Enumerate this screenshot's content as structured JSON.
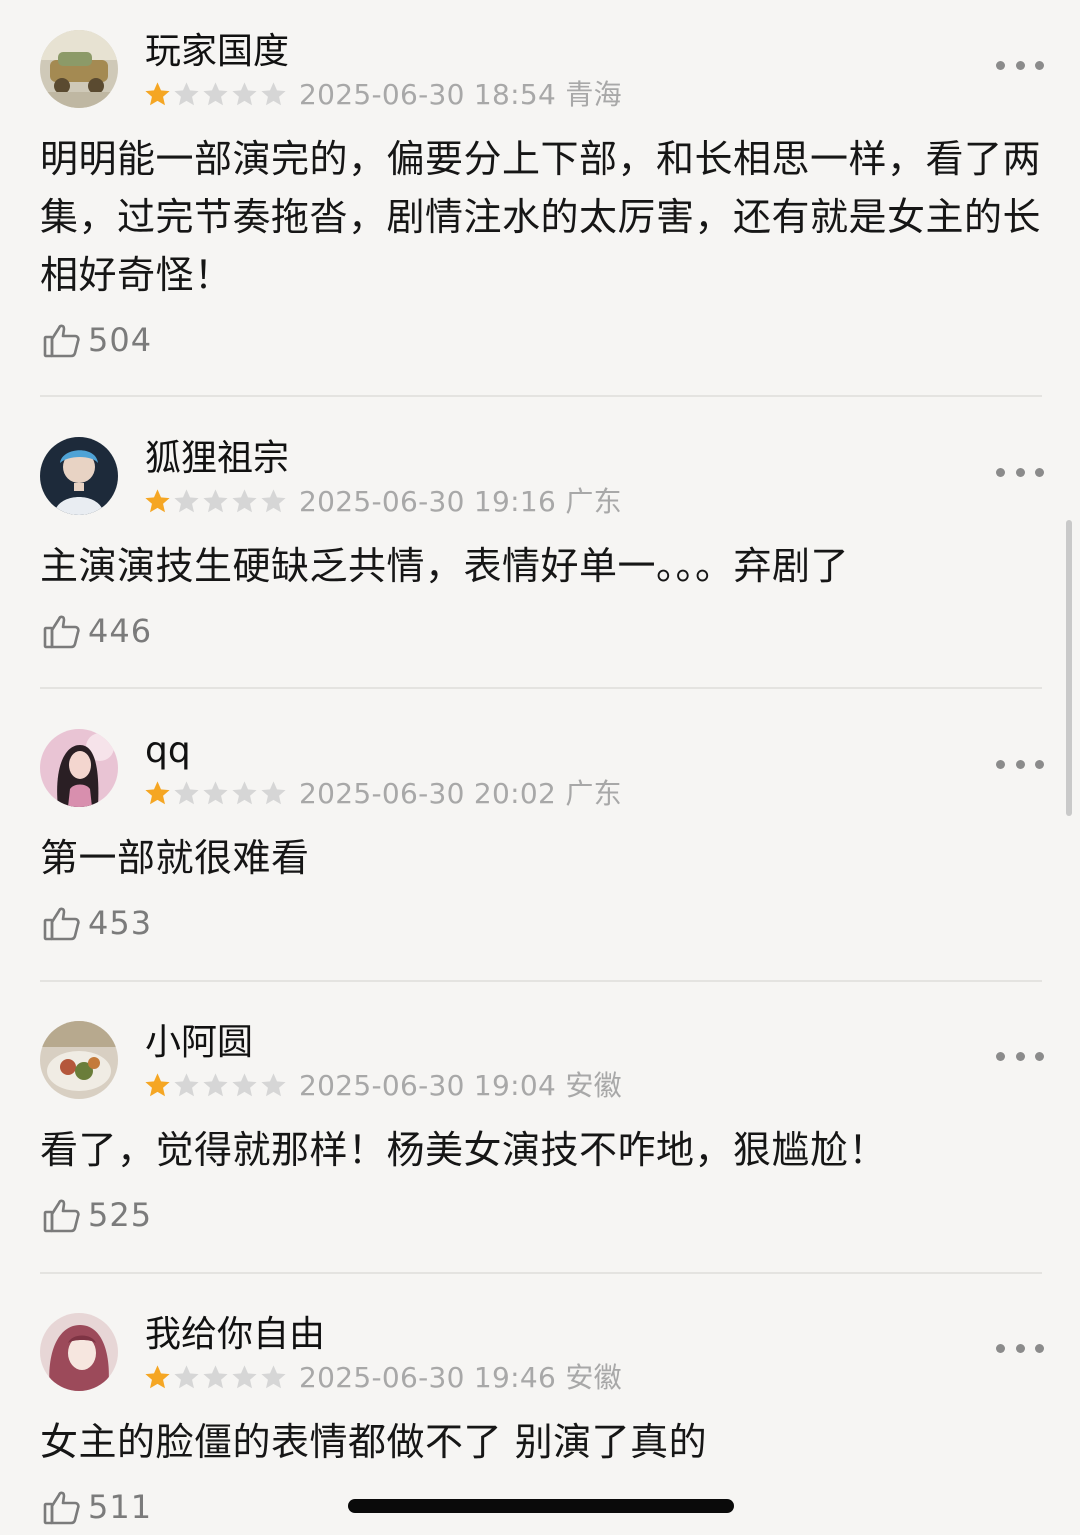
{
  "comments": [
    {
      "username": "玩家国度",
      "rating": 1,
      "datetime": "2025-06-30 18:54",
      "location": "青海",
      "text": "明明能一部演完的，偏要分上下部，和长相思一样，看了两集，过完节奏拖沓，剧情注水的太厉害，还有就是女主的长相好奇怪！",
      "likes": "504",
      "avatar_icon": "avatar-gold-car"
    },
    {
      "username": "狐狸祖宗",
      "rating": 1,
      "datetime": "2025-06-30 19:16",
      "location": "广东",
      "text": "主演演技生硬缺乏共情，表情好单一。。。弃剧了",
      "likes": "446",
      "avatar_icon": "avatar-blue-hair-person"
    },
    {
      "username": "qq",
      "rating": 1,
      "datetime": "2025-06-30 20:02",
      "location": "广东",
      "text": "第一部就很难看",
      "likes": "453",
      "avatar_icon": "avatar-girl-pink"
    },
    {
      "username": "小阿圆",
      "rating": 1,
      "datetime": "2025-06-30 19:04",
      "location": "安徽",
      "text": "看了，觉得就那样！杨美女演技不咋地，狠尴尬！",
      "likes": "525",
      "avatar_icon": "avatar-food-plate"
    },
    {
      "username": "我给你自由",
      "rating": 1,
      "datetime": "2025-06-30 19:46",
      "location": "安徽",
      "text": "女主的脸僵的表情都做不了 别演了真的",
      "likes": "511",
      "avatar_icon": "avatar-anime-girl"
    }
  ],
  "colors": {
    "star_filled": "#f5a623",
    "star_empty": "#d6d6d6",
    "meta_text": "#a8a8a8",
    "background": "#f6f5f3"
  }
}
